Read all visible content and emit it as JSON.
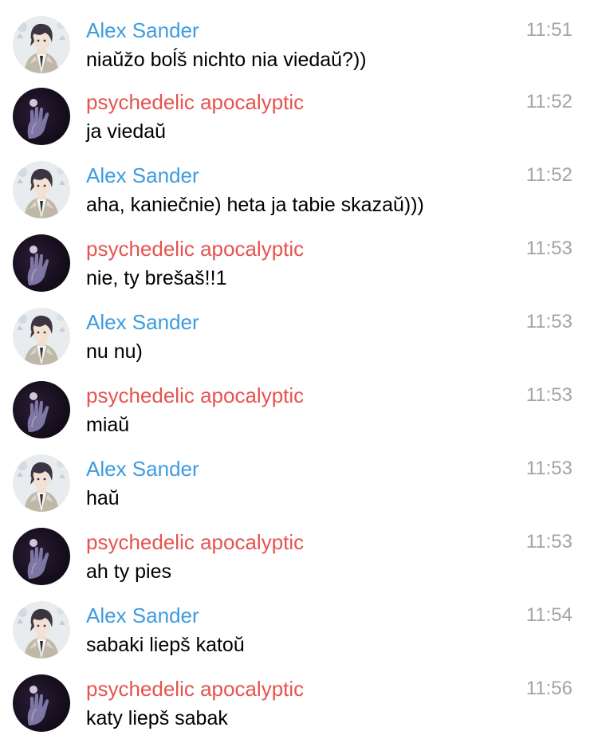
{
  "colors": {
    "alex_name": "#3d9be0",
    "psychedelic_name": "#e5544f",
    "timestamp": "#a3a3a8",
    "message_text": "#000000"
  },
  "messages": [
    {
      "sender": "Alex Sander",
      "role": "alex",
      "avatar": "anime-character-avatar",
      "time": "11:51",
      "text": "niaŭžo boĺš nichto nia viedaŭ?))"
    },
    {
      "sender": "psychedelic apocalyptic",
      "role": "psy",
      "avatar": "dark-hand-moon-avatar",
      "time": "11:52",
      "text": "ja viedaŭ"
    },
    {
      "sender": "Alex Sander",
      "role": "alex",
      "avatar": "anime-character-avatar",
      "time": "11:52",
      "text": "aha, kaniečnie) heta ja tabie skazaŭ)))"
    },
    {
      "sender": "psychedelic apocalyptic",
      "role": "psy",
      "avatar": "dark-hand-moon-avatar",
      "time": "11:53",
      "text": "nie, ty brešaš!!1"
    },
    {
      "sender": "Alex Sander",
      "role": "alex",
      "avatar": "anime-character-avatar",
      "time": "11:53",
      "text": "nu nu)"
    },
    {
      "sender": "psychedelic apocalyptic",
      "role": "psy",
      "avatar": "dark-hand-moon-avatar",
      "time": "11:53",
      "text": "miaŭ"
    },
    {
      "sender": "Alex Sander",
      "role": "alex",
      "avatar": "anime-character-avatar",
      "time": "11:53",
      "text": "haŭ"
    },
    {
      "sender": "psychedelic apocalyptic",
      "role": "psy",
      "avatar": "dark-hand-moon-avatar",
      "time": "11:53",
      "text": "ah ty pies"
    },
    {
      "sender": "Alex Sander",
      "role": "alex",
      "avatar": "anime-character-avatar",
      "time": "11:54",
      "text": "sabaki liepš katoŭ"
    },
    {
      "sender": "psychedelic apocalyptic",
      "role": "psy",
      "avatar": "dark-hand-moon-avatar",
      "time": "11:56",
      "text": "katy liepš sabak"
    }
  ]
}
